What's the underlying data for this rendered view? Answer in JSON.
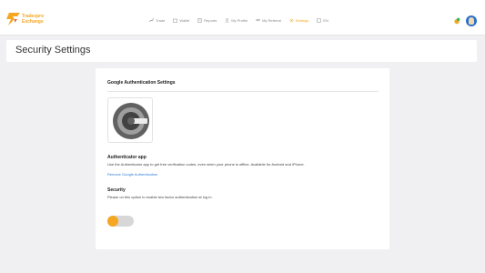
{
  "brand": {
    "line1": "Tradexpro",
    "line2": "Exchange",
    "accent": "#f5a623"
  },
  "nav": {
    "items": [
      {
        "label": "Trade",
        "icon": "chart-icon"
      },
      {
        "label": "Wallet",
        "icon": "wallet-icon"
      },
      {
        "label": "Reports",
        "icon": "report-icon"
      },
      {
        "label": "My Profile",
        "icon": "user-icon"
      },
      {
        "label": "My Referral",
        "icon": "referral-icon"
      },
      {
        "label": "Settings",
        "icon": "gear-icon",
        "active": true
      },
      {
        "label": "EN",
        "icon": "language-icon"
      }
    ]
  },
  "page": {
    "title": "Security Settings"
  },
  "card": {
    "title": "Google Authentication Settings",
    "authenticator": {
      "heading": "Authenticator app",
      "description": "Use the Authenticator app to get free verification codes, even when your phone is offline. Available for Android and iPhone.",
      "link": "Remove Google Authentication"
    },
    "security": {
      "heading": "Security",
      "description": "Please on this option to enable two factor authentication at log In."
    }
  },
  "colors": {
    "link": "#2d7fd6",
    "toggle_active": "#f5a623",
    "avatar": "#2a72c9"
  }
}
